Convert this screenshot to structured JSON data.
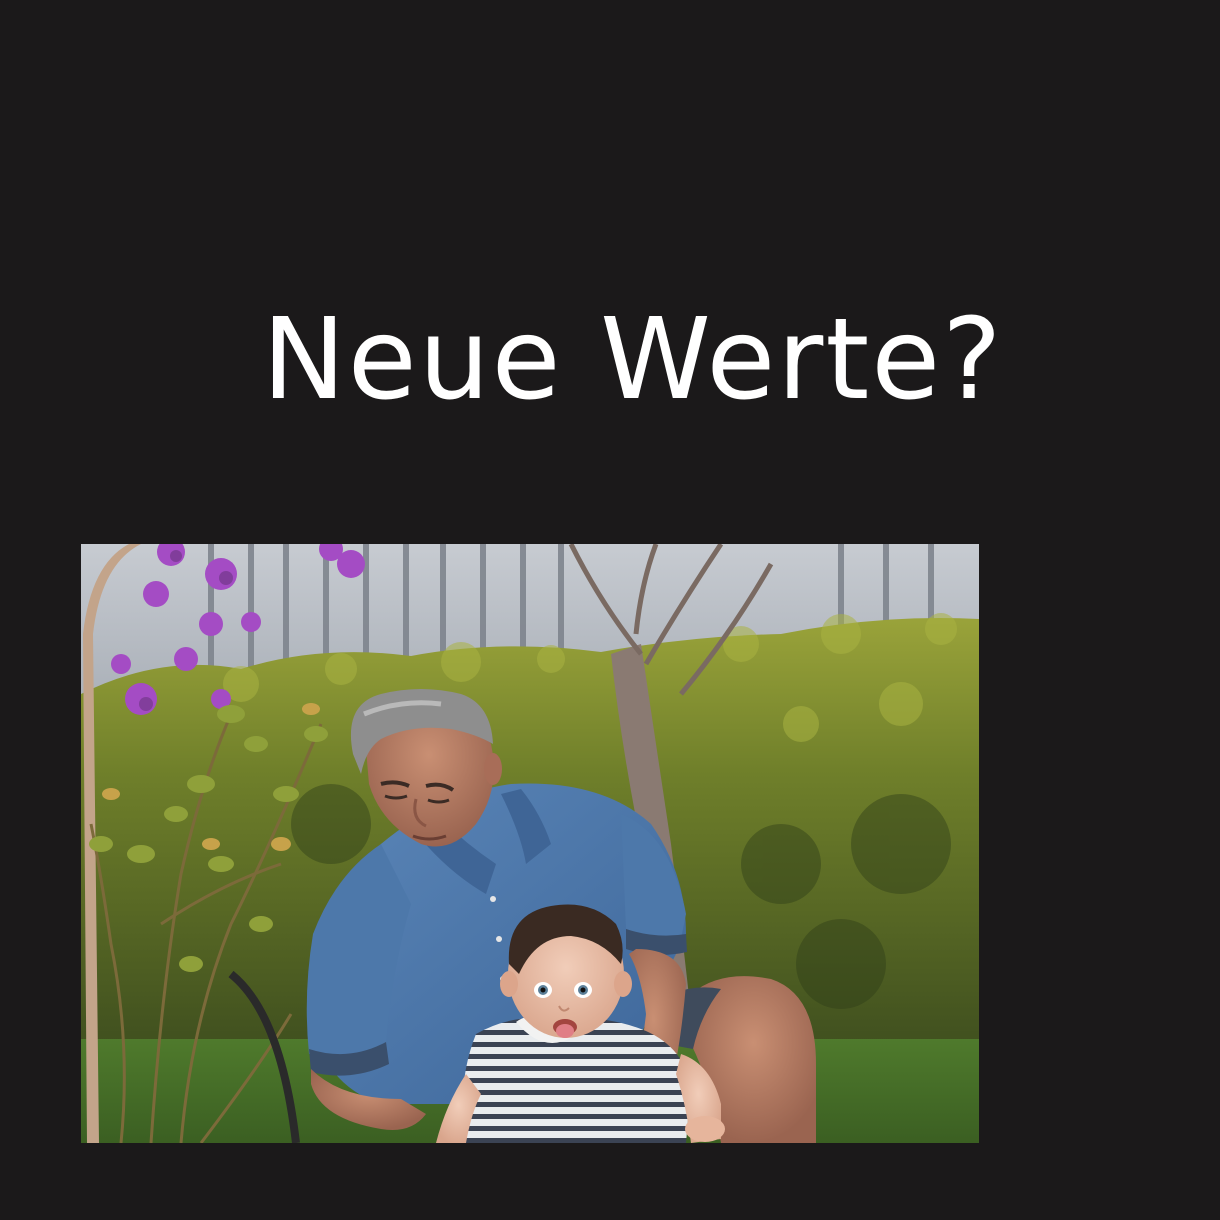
{
  "slide": {
    "title": "Neue Werte?",
    "background_color": "#1b191a",
    "title_color": "#ffffff"
  },
  "photo": {
    "subject": "grandfather-with-baby-in-garden"
  }
}
